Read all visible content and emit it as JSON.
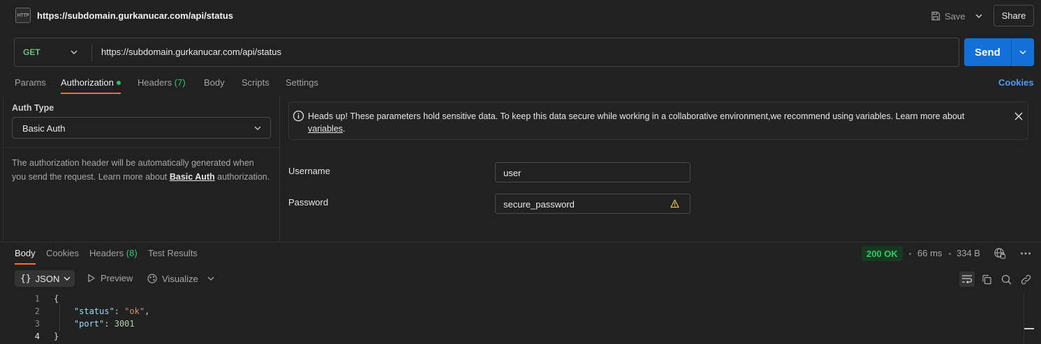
{
  "titlebar": {
    "badge_text": "HTTP",
    "title": "https://subdomain.gurkanucar.com/api/status",
    "save_label": "Save",
    "share_label": "Share"
  },
  "request": {
    "method": "GET",
    "url": "https://subdomain.gurkanucar.com/api/status",
    "send_label": "Send"
  },
  "tabs": {
    "params": "Params",
    "authorization": "Authorization",
    "headers": "Headers",
    "headers_count": "(7)",
    "body": "Body",
    "scripts": "Scripts",
    "settings": "Settings",
    "cookies": "Cookies"
  },
  "auth": {
    "type_label": "Auth Type",
    "type_value": "Basic Auth",
    "help_text_1": "The authorization header will be automatically generated when you send the request. Learn more about ",
    "help_link": "Basic Auth",
    "help_text_2": " authorization.",
    "notice_text": "Heads up! These parameters hold sensitive data. To keep this data secure while working in a collaborative environment,we recommend using variables. Learn more about ",
    "notice_link": "variables",
    "notice_end": ".",
    "username_label": "Username",
    "username_value": "user",
    "password_label": "Password",
    "password_value": "secure_password"
  },
  "response": {
    "tabs": {
      "body": "Body",
      "cookies": "Cookies",
      "headers": "Headers",
      "headers_count": "(8)",
      "test_results": "Test Results"
    },
    "status": "200 OK",
    "time": "66 ms",
    "size": "334 B",
    "format": "JSON",
    "format_braces": "{}",
    "preview_label": "Preview",
    "visualize_label": "Visualize",
    "lines": {
      "n1": "1",
      "n2": "2",
      "n3": "3",
      "n4": "4",
      "open": "{",
      "close": "}",
      "k_status": "\"status\"",
      "v_status": "\"ok\"",
      "k_port": "\"port\"",
      "v_port": "3001"
    }
  },
  "colors": {
    "accent": "#ff6c37",
    "send": "#1470d9",
    "success": "#35c86a",
    "link": "#4e9cf5"
  }
}
